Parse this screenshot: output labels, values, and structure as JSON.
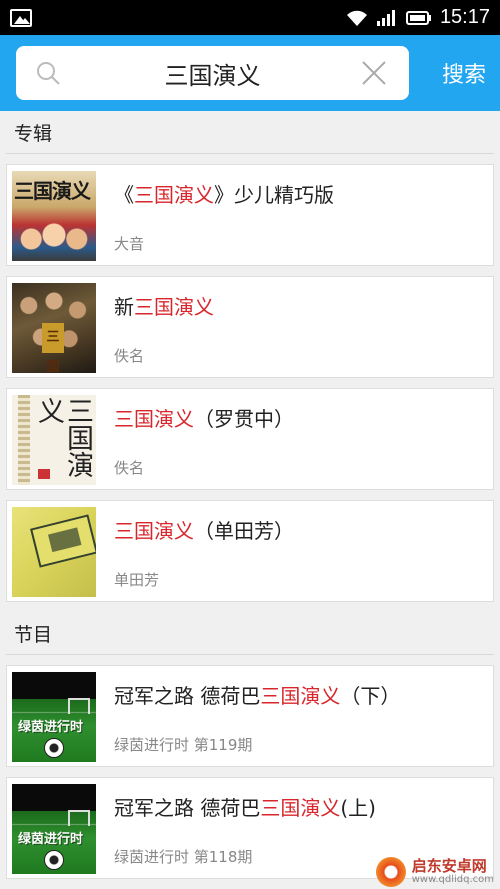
{
  "status_bar": {
    "time": "15:17",
    "icons": [
      "gallery-icon",
      "wifi-icon",
      "signal-icon",
      "battery-icon"
    ]
  },
  "search": {
    "query": "三国演义",
    "button_label": "搜索",
    "icons": [
      "search-icon",
      "clear-icon"
    ]
  },
  "albums": {
    "header": "专辑",
    "items": [
      {
        "title_pre": "《",
        "title_hl": "三国演义",
        "title_post": "》少儿精巧版",
        "subtitle": "大音",
        "thumb_text": "三国演义"
      },
      {
        "title_pre": "新",
        "title_hl": "三国演义",
        "title_post": "",
        "subtitle": "佚名",
        "thumb_text": "三国"
      },
      {
        "title_pre": "",
        "title_hl": "三国演义",
        "title_post": "（罗贯中）",
        "subtitle": "佚名",
        "thumb_text": "三国演义"
      },
      {
        "title_pre": "",
        "title_hl": "三国演义",
        "title_post": "（单田芳）",
        "subtitle": "单田芳",
        "thumb_text": ""
      }
    ]
  },
  "programs": {
    "header": "节目",
    "items": [
      {
        "title_pre": "冠军之路 德荷巴",
        "title_hl": "三国演义",
        "title_post": "（下）",
        "subtitle": "绿茵进行时 第119期",
        "thumb_text": "绿茵进行时"
      },
      {
        "title_pre": "冠军之路 德荷巴",
        "title_hl": "三国演义",
        "title_post": "(上)",
        "subtitle": "绿茵进行时 第118期",
        "thumb_text": "绿茵进行时"
      }
    ]
  },
  "watermark": {
    "name": "启东安卓网",
    "url": "www.qdlidq.com"
  },
  "colors": {
    "accent": "#22a6f0",
    "highlight": "#d8262b"
  }
}
